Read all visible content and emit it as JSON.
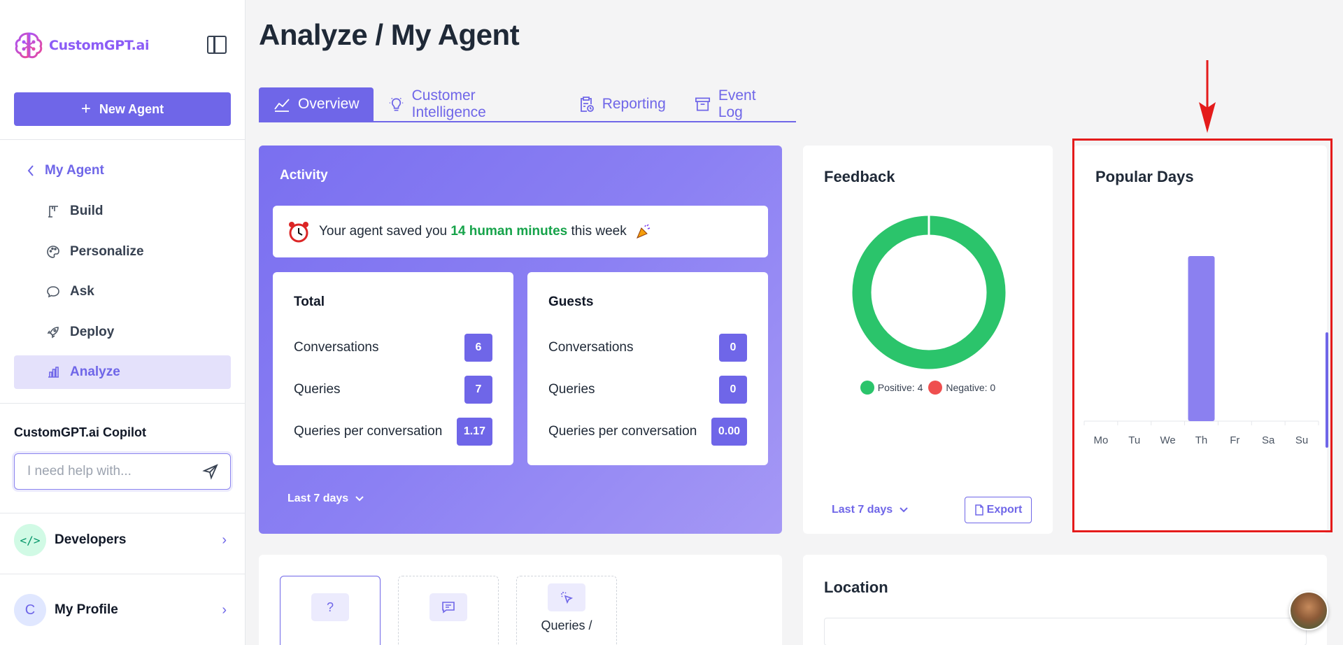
{
  "sidebar": {
    "logo_text": "CustomGPT.ai",
    "new_agent_label": "New Agent",
    "back_label": "My Agent",
    "items": [
      {
        "label": "Build",
        "icon": "crane-icon"
      },
      {
        "label": "Personalize",
        "icon": "palette-icon"
      },
      {
        "label": "Ask",
        "icon": "chat-bubble-icon"
      },
      {
        "label": "Deploy",
        "icon": "rocket-icon"
      },
      {
        "label": "Analyze",
        "icon": "bar-chart-icon",
        "active": true
      }
    ],
    "copilot_title": "CustomGPT.ai Copilot",
    "copilot_placeholder": "I need help with...",
    "developers_label": "Developers",
    "profile_initial": "C",
    "profile_label": "My Profile"
  },
  "header": {
    "title": "Analyze / My Agent"
  },
  "tabs": [
    {
      "label": "Overview",
      "icon": "line-chart-icon",
      "active": true
    },
    {
      "label": "Customer Intelligence",
      "icon": "lightbulb-icon"
    },
    {
      "label": "Reporting",
      "icon": "clipboard-icon"
    },
    {
      "label": "Event Log",
      "icon": "archive-icon"
    }
  ],
  "activity": {
    "title": "Activity",
    "saved_prefix": "Your agent saved you",
    "saved_highlight": "14 human minutes",
    "saved_suffix": "this week",
    "total": {
      "title": "Total",
      "rows": [
        {
          "label": "Conversations",
          "value": "6"
        },
        {
          "label": "Queries",
          "value": "7"
        },
        {
          "label": "Queries per conversation",
          "value": "1.17"
        }
      ]
    },
    "guests": {
      "title": "Guests",
      "rows": [
        {
          "label": "Conversations",
          "value": "0"
        },
        {
          "label": "Queries",
          "value": "0"
        },
        {
          "label": "Queries per conversation",
          "value": "0.00"
        }
      ]
    },
    "range_label": "Last 7 days"
  },
  "feedback": {
    "title": "Feedback",
    "positive_label": "Positive: 4",
    "negative_label": "Negative: 0",
    "positive_color": "#2bc46b",
    "negative_color": "#ef4f4f",
    "range_label": "Last 7 days",
    "export_label": "Export"
  },
  "popular_days": {
    "title": "Popular Days",
    "bar_color": "#8b80f0"
  },
  "chart_data": [
    {
      "type": "pie",
      "labels": [
        "Positive",
        "Negative"
      ],
      "values": [
        4,
        0
      ],
      "legend": "bottom"
    },
    {
      "type": "bar",
      "title": "Popular Days",
      "categories": [
        "Mo",
        "Tu",
        "We",
        "Th",
        "Fr",
        "Sa",
        "Su"
      ],
      "values": [
        0,
        0,
        0,
        1,
        0,
        0,
        0
      ],
      "grid": false
    }
  ],
  "queries_section": {
    "cards": [
      {
        "icon": "question-icon",
        "label": ""
      },
      {
        "icon": "message-icon",
        "label": ""
      },
      {
        "icon": "cursor-click-icon",
        "label": "Queries /"
      }
    ]
  },
  "location": {
    "title": "Location"
  }
}
